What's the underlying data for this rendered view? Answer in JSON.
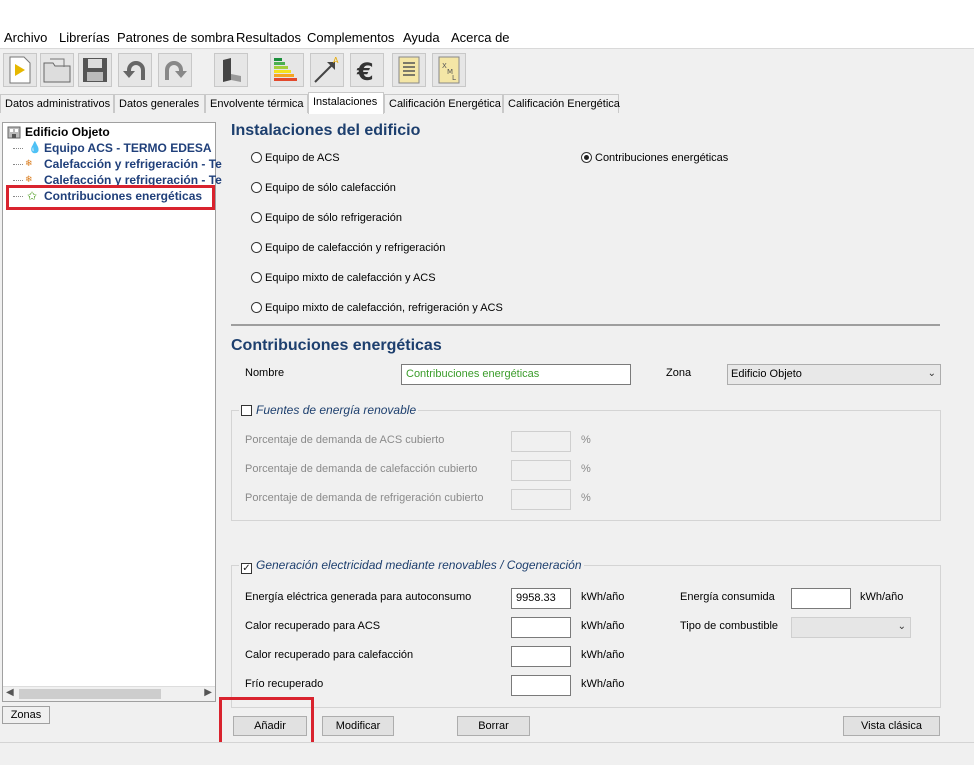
{
  "menu": [
    "Archivo",
    "Librerías",
    "Patrones de sombra",
    "Resultados",
    "Complementos",
    "Ayuda",
    "Acerca de"
  ],
  "toolbar": {
    "icons": [
      "new-file-icon",
      "open-folder-icon",
      "save-disk-icon",
      "undo-icon",
      "redo-icon",
      "building-block-icon",
      "energy-rating-icon",
      "arrow-chart-icon",
      "euro-icon",
      "document-list-icon",
      "xml-file-icon"
    ]
  },
  "tabs": [
    "Datos administrativos",
    "Datos generales",
    "Envolvente térmica",
    "Instalaciones",
    "Calificación Energética",
    "Calificación Energética"
  ],
  "tree": {
    "root": "Edificio Objeto",
    "items": [
      "Equipo ACS - TERMO EDESA",
      "Calefacción y refrigeración - Te",
      "Calefacción y refrigeración - Te",
      "Contribuciones energéticas"
    ]
  },
  "zonas_tab": "Zonas",
  "instalaciones": {
    "title": "Instalaciones del edificio",
    "options": [
      "Equipo de ACS",
      "Equipo de sólo calefacción",
      "Equipo de sólo refrigeración",
      "Equipo de calefacción y refrigeración",
      "Equipo mixto de calefacción y ACS",
      "Equipo mixto de calefacción, refrigeración y ACS"
    ],
    "contribuciones_option": "Contribuciones energéticas",
    "selected": "Contribuciones energéticas"
  },
  "contribuciones": {
    "title": "Contribuciones energéticas",
    "nombre_label": "Nombre",
    "nombre_value": "Contribuciones energéticas",
    "zona_label": "Zona",
    "zona_value": "Edificio Objeto",
    "fuentes": {
      "title": "Fuentes de energía renovable",
      "checked": false,
      "rows": [
        {
          "label": "Porcentaje de demanda de ACS cubierto",
          "unit": "%",
          "value": ""
        },
        {
          "label": "Porcentaje de demanda de calefacción cubierto",
          "unit": "%",
          "value": ""
        },
        {
          "label": "Porcentaje de demanda de refrigeración cubierto",
          "unit": "%",
          "value": ""
        }
      ]
    },
    "generacion": {
      "title": "Generación electricidad mediante renovables / Cogeneración",
      "checked": true,
      "check_glyph": "✓",
      "rows": [
        {
          "label": "Energía eléctrica generada para autoconsumo",
          "value": "9958.33",
          "unit": "kWh/año"
        },
        {
          "label": "Calor recuperado para ACS",
          "value": "",
          "unit": "kWh/año"
        },
        {
          "label": "Calor recuperado para calefacción",
          "value": "",
          "unit": "kWh/año"
        },
        {
          "label": "Frío recuperado",
          "value": "",
          "unit": "kWh/año"
        }
      ],
      "energia_consumida_label": "Energía consumida",
      "energia_consumida_value": "",
      "energia_consumida_unit": "kWh/año",
      "tipo_combustible_label": "Tipo de combustible",
      "tipo_combustible_value": ""
    }
  },
  "buttons": {
    "add": "Añadir",
    "modify": "Modificar",
    "delete": "Borrar",
    "classic": "Vista clásica"
  },
  "colors": {
    "accent": "#1d3f6e",
    "highlight": "#d9232e",
    "tree_text": "#1f3f7a",
    "input_green": "#3a9c2a"
  }
}
